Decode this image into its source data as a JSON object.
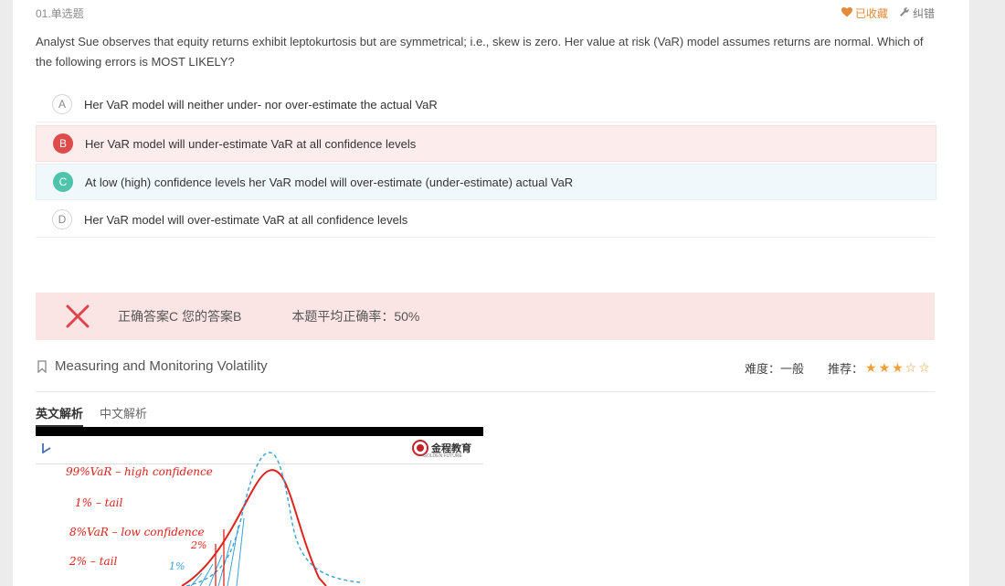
{
  "question": {
    "number_label": "01.单选题",
    "favorite_label": "已收藏",
    "correction_label": "纠错",
    "text": "Analyst Sue observes that equity returns exhibit leptokurtosis but are symmetrical; i.e., skew is zero. Her value at risk (VaR) model assumes returns are normal. Which of the following errors is MOST LIKELY?"
  },
  "options": [
    {
      "letter": "A",
      "text": "Her VaR model will neither under- nor over-estimate the actual VaR",
      "state": "none"
    },
    {
      "letter": "B",
      "text": "Her VaR model will under-estimate VaR at all confidence levels",
      "state": "wrong"
    },
    {
      "letter": "C",
      "text": "At low (high) confidence levels her VaR model will over-estimate (under-estimate) actual VaR",
      "state": "correct"
    },
    {
      "letter": "D",
      "text": "Her VaR model will over-estimate VaR at all confidence levels",
      "state": "none"
    }
  ],
  "result": {
    "answer_text": "正确答案C 您的答案B",
    "rate_text": "本题平均正确率：50%"
  },
  "knowledge": {
    "title": "Measuring and Monitoring Volatility",
    "difficulty_label": "难度：",
    "difficulty_value": "一般",
    "recommend_label": "推荐：",
    "recommend_stars": 3,
    "recommend_max": 5
  },
  "tabs": [
    {
      "label": "英文解析",
      "active": true
    },
    {
      "label": "中文解析",
      "active": false
    }
  ],
  "video": {
    "logo_text": "金程教育",
    "logo_sub": "GOLDEN FUTURE",
    "notes": [
      "99%VaR – high confidence",
      "1% – tail",
      "8%VaR – low confidence",
      "2% – tail",
      "2%",
      "1%"
    ]
  },
  "colors": {
    "accent_orange": "#e5893a",
    "wrong_red": "#dd4b4b",
    "correct_green": "#4fc3ab",
    "result_bg": "#fbe4e4",
    "star": "#f0a035"
  }
}
